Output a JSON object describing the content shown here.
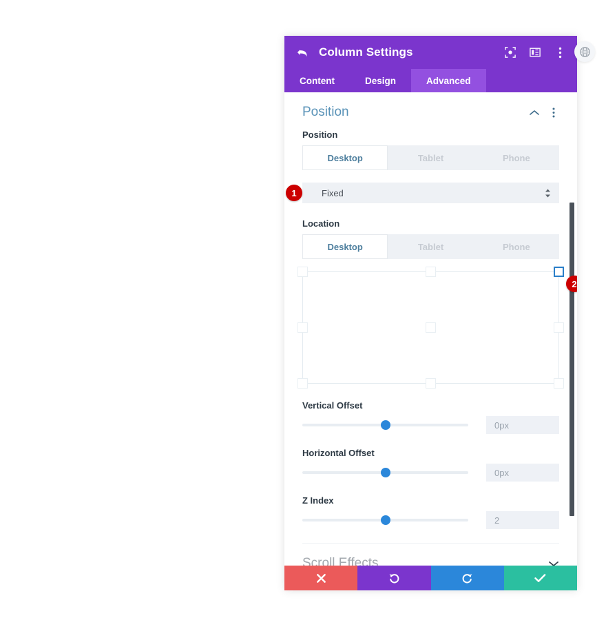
{
  "header": {
    "title": "Column Settings",
    "back_icon": "back-arrow-icon",
    "icons": [
      "focus-target-icon",
      "layout-panel-icon",
      "kebab-menu-icon"
    ]
  },
  "tabs": [
    {
      "label": "Content",
      "active": false
    },
    {
      "label": "Design",
      "active": false
    },
    {
      "label": "Advanced",
      "active": true
    }
  ],
  "position_section": {
    "title": "Position",
    "collapse_icon": "chevron-up-icon",
    "menu_icon": "kebab-menu-icon",
    "position_field": {
      "label": "Position",
      "devices": [
        {
          "label": "Desktop",
          "active": true
        },
        {
          "label": "Tablet",
          "active": false
        },
        {
          "label": "Phone",
          "active": false
        }
      ],
      "select_value": "Fixed",
      "badge": "1"
    },
    "location_field": {
      "label": "Location",
      "devices": [
        {
          "label": "Desktop",
          "active": true
        },
        {
          "label": "Tablet",
          "active": false
        },
        {
          "label": "Phone",
          "active": false
        }
      ],
      "selected_cell": "top-right",
      "badge": "2"
    },
    "sliders": [
      {
        "label": "Vertical Offset",
        "value": "0px",
        "handle_percent": 50
      },
      {
        "label": "Horizontal Offset",
        "value": "0px",
        "handle_percent": 50
      },
      {
        "label": "Z Index",
        "value": "2",
        "handle_percent": 50
      }
    ]
  },
  "scroll_effects_section": {
    "title": "Scroll Effects",
    "expand_icon": "chevron-down-icon"
  },
  "footer": {
    "buttons": [
      {
        "name": "cancel",
        "icon": "close-x-icon",
        "color": "#eb5a5a"
      },
      {
        "name": "undo",
        "icon": "undo-arrow-icon",
        "color": "#7b35cd"
      },
      {
        "name": "redo",
        "icon": "redo-arrow-icon",
        "color": "#2b87da"
      },
      {
        "name": "save",
        "icon": "checkmark-icon",
        "color": "#2bbfa0"
      }
    ]
  },
  "side_chip": {
    "icon": "globe-icon"
  },
  "colors": {
    "header_purple": "#7b35cd",
    "active_tab_purple": "#9350e0",
    "accent_blue": "#2b87da",
    "section_title_blue": "#5a93b8",
    "badge_red": "#cc0000"
  }
}
